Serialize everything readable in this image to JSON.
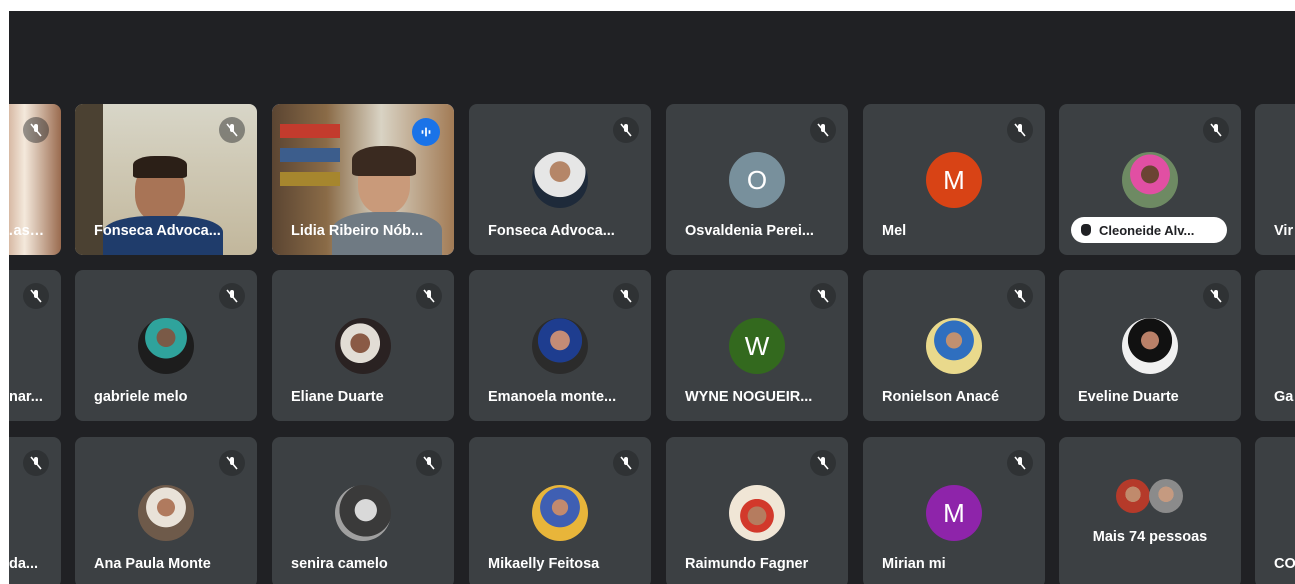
{
  "grid": {
    "row1": [
      {
        "name": "…ass…",
        "type": "video"
      },
      {
        "name": "Fonseca Advoca...",
        "type": "video"
      },
      {
        "name": "Lidia Ribeiro Nób...",
        "type": "video",
        "speaking": true
      },
      {
        "name": "Fonseca Advoca...",
        "type": "photo"
      },
      {
        "name": "Osvaldenia Perei...",
        "type": "letter",
        "letter": "O",
        "color": "#78909c"
      },
      {
        "name": "Mel",
        "type": "letter",
        "letter": "M",
        "color": "#d84315"
      },
      {
        "name": "Cleoneide Alv...",
        "type": "photo",
        "pill": true
      },
      {
        "name": "Vir"
      }
    ],
    "row2": [
      {
        "name": "nar..."
      },
      {
        "name": "gabriele melo",
        "type": "photo"
      },
      {
        "name": "Eliane Duarte",
        "type": "photo"
      },
      {
        "name": "Emanoela monte...",
        "type": "photo"
      },
      {
        "name": "WYNE NOGUEIR...",
        "type": "letter",
        "letter": "W",
        "color": "#33691e"
      },
      {
        "name": "Ronielson Anacé",
        "type": "photo"
      },
      {
        "name": "Eveline Duarte",
        "type": "photo"
      },
      {
        "name": "Ga"
      }
    ],
    "row3": [
      {
        "name": "da..."
      },
      {
        "name": "Ana Paula Monte",
        "type": "photo"
      },
      {
        "name": "senira camelo",
        "type": "photo"
      },
      {
        "name": "Mikaelly Feitosa",
        "type": "photo"
      },
      {
        "name": "Raimundo Fagner",
        "type": "photo"
      },
      {
        "name": "Mirian mi",
        "type": "letter",
        "letter": "M",
        "color": "#8e24aa"
      },
      {
        "name": "Mais 74 pessoas",
        "type": "more"
      },
      {
        "name": "CO"
      }
    ]
  },
  "colors": {
    "background": "#202124",
    "tile": "#3c4043",
    "speaking_border": "#8ab4f8",
    "speak_badge": "#1a73e8"
  },
  "icons": {
    "mic_off": "mic-off-icon",
    "speaking": "audio-level-icon",
    "hand": "raised-hand-icon"
  }
}
